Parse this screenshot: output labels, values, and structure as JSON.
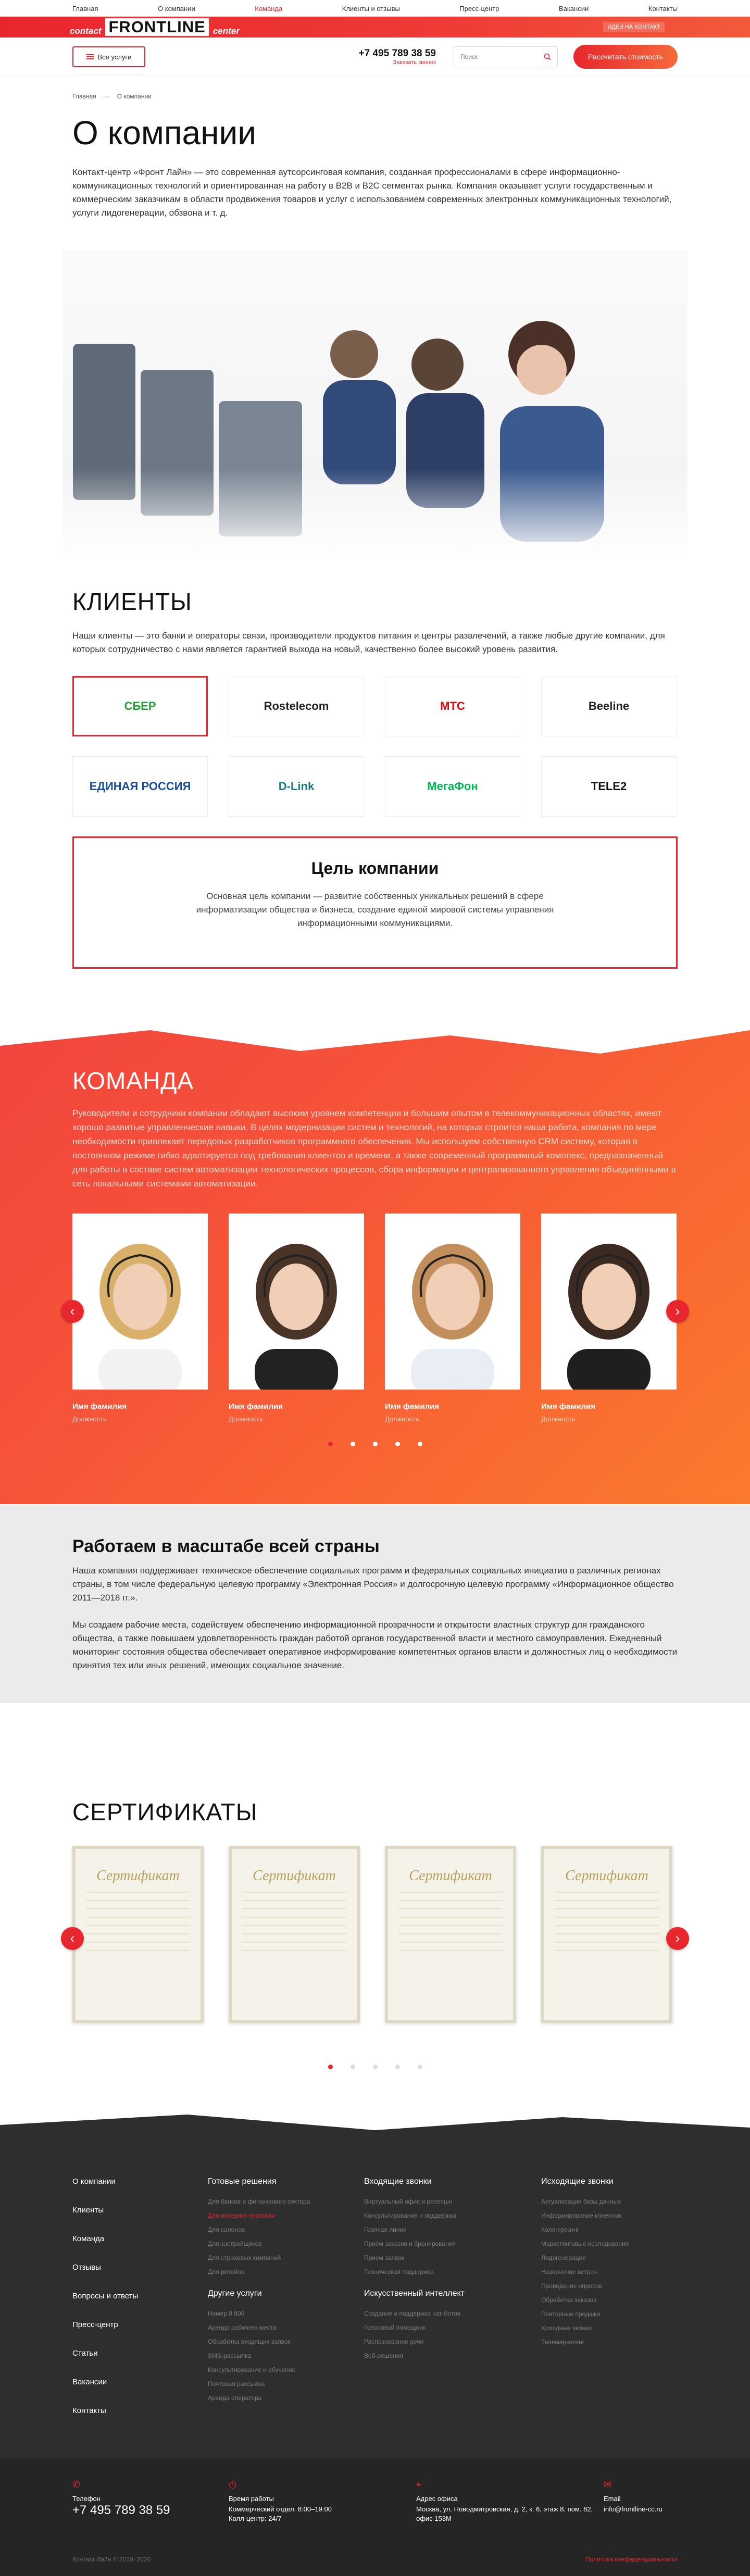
{
  "topnav": {
    "items": [
      "Главная",
      "О компании",
      "Команда",
      "Клиенты и отзывы",
      "Пресс-центр",
      "Вакансии",
      "Контакты"
    ],
    "active_index": 2
  },
  "brand": {
    "left": "contact",
    "big": "FRONTLINE",
    "right": "center",
    "feedback": "ИДЕИ НА КОНТАКТ"
  },
  "header": {
    "services": "Все услуги",
    "phone": "+7 495 789 38 59",
    "callback": "Заказать звонок",
    "search_placeholder": "Поиск",
    "calc": "Рассчитать стоимость"
  },
  "crumbs": [
    "Главная",
    "О компании"
  ],
  "page": {
    "title": "О компании",
    "lead": "Контакт-центр «Фронт Лайн» — это современная аутсорсинговая компания, созданная профессионалами в сфере информационно-коммуникационных технологий и ориентированная на работу в B2B и B2C сегментах рынка. Компания оказывает услуги государственным и коммерческим заказчикам в области продвижения товаров и услуг с использованием современных электронных коммуникационных технологий, услуги лидогенерации, обзвона и т. д."
  },
  "clients": {
    "title": "КЛИЕНТЫ",
    "text": "Наши клиенты — это банки и операторы связи, производители продуктов питания и центры развлечений, а также любые другие компании, для которых сотрудничество с нами является гарантией выхода на новый, качественно более высокий уровень развития.",
    "logos": [
      {
        "name": "СБЕР",
        "color": "#21a038"
      },
      {
        "name": "Rostelecom",
        "color": "#222"
      },
      {
        "name": "МТС",
        "color": "#e30611"
      },
      {
        "name": "Beeline",
        "color": "#222"
      },
      {
        "name": "ЕДИНАЯ РОССИЯ",
        "color": "#1b4c9a"
      },
      {
        "name": "D-Link",
        "color": "#167c80"
      },
      {
        "name": "МегаФон",
        "color": "#00b956"
      },
      {
        "name": "TELE2",
        "color": "#111"
      }
    ],
    "goal_title": "Цель компании",
    "goal_text": "Основная цель компании — развитие собственных уникальных решений в сфере информатизации общества и бизнеса, создание единой мировой системы управления информационными коммуникациями."
  },
  "team": {
    "title": "КОМАНДА",
    "text": "Руководители и сотрудники компании обладают высоким уровнем компетенции и большим опытом в телекоммуникационных областях, имеют хорошо развитые управленческие навыки. В целях модернизации систем и технологий, на которых строится наша работа, компания по мере необходимости привлекает передовых разработчиков программного обеспечения. Мы используем собственную CRM систему, которая в постоянном режиме гибко адаптируется под требования клиентов и времени, а также современный программный комплекс, предназначенный для работы в составе систем автоматизации технологических процессов, сбора информации и централизованного управления объединёнными в сеть локальными системами автоматизации.",
    "members": [
      {
        "name": "Имя фамилия",
        "pos": "Должность"
      },
      {
        "name": "Имя фамилия",
        "pos": "Должность"
      },
      {
        "name": "Имя фамилия",
        "pos": "Должность"
      },
      {
        "name": "Имя фамилия",
        "pos": "Должность"
      }
    ]
  },
  "country": {
    "title": "Работаем в масштабе всей страны",
    "p1": "Наша компания поддерживает техническое обеспечение социальных программ и федеральных социальных инициатив в различных регионах страны, в том числе федеральную целевую программу «Электронная Россия» и долгосрочную целевую программу «Информационное общество 2011—2018 гг.».",
    "p2": "Мы создаем рабочие места, содействуем обеспечению информационной прозрачности и открытости властных структур для гражданского общества, а также повышаем удовлетворенность граждан работой органов государственной власти и местного самоуправления. Ежедневный мониторинг состояния общества обеспечивает оперативное информирование компетентных органов власти и должностных лиц о необходимости принятия тех или иных решений, имеющих социальное значение."
  },
  "certs": {
    "title": "СЕРТИФИКАТЫ",
    "label": "Сертификат"
  },
  "footer": {
    "main": [
      "О компании",
      "Клиенты",
      "Команда",
      "Отзывы",
      "Вопросы и ответы",
      "Пресс-центр",
      "Статьи",
      "Вакансии",
      "Контакты"
    ],
    "col2_head": "Готовые решения",
    "col2": [
      "Для банков и финансового сектора",
      "Для интернет-торговли",
      "Для салонов",
      "Для застройщиков",
      "Для страховых компаний",
      "Для ритейла"
    ],
    "col2b_head": "Другие услуги",
    "col2b": [
      "Номер 8 800",
      "Аренда рабочего места",
      "Обработка входящих заявок",
      "SMS-рассылка",
      "Консультирование и обучение",
      "Почтовая рассылка",
      "Аренда оператора"
    ],
    "col3_head": "Входящие звонки",
    "col3": [
      "Виртуальный офис и ресепшн",
      "Консультирование и поддержка",
      "Горячая линия",
      "Приём заказов и бронирования",
      "Прием заявок",
      "Техническая поддержка"
    ],
    "col3b_head": "Искусственный интеллект",
    "col3b": [
      "Создание и поддержка чат-ботов",
      "Голосовой помощник",
      "Распознавание речи",
      "Веб-решения"
    ],
    "col4_head": "Исходящие звонки",
    "col4": [
      "Актуализация базы данных",
      "Информирование клиентов",
      "Колл-трекинг",
      "Маркетинговые исследования",
      "Лидогенерация",
      "Назначение встреч",
      "Проведение опросов",
      "Обработка заказов",
      "Повторные продажи",
      "Холодные звонки",
      "Телемаркетинг"
    ],
    "phone_label": "Телефон",
    "phone": "+7 495 789 38 59",
    "hours_label": "Время работы",
    "hours": "Коммерческий отдел: 8:00–19:00\nКолл-центр: 24/7",
    "address_label": "Адрес офиса",
    "address": "Москва, ул. Новодмитровская, д. 2, к. 6, этаж 8, пом. 82, офис 153М",
    "email_label": "Email",
    "email": "info@frontline-cc.ru",
    "copyright": "Контакт Лайн © 2010–2020",
    "policy": "Политика конфиденциальности"
  }
}
